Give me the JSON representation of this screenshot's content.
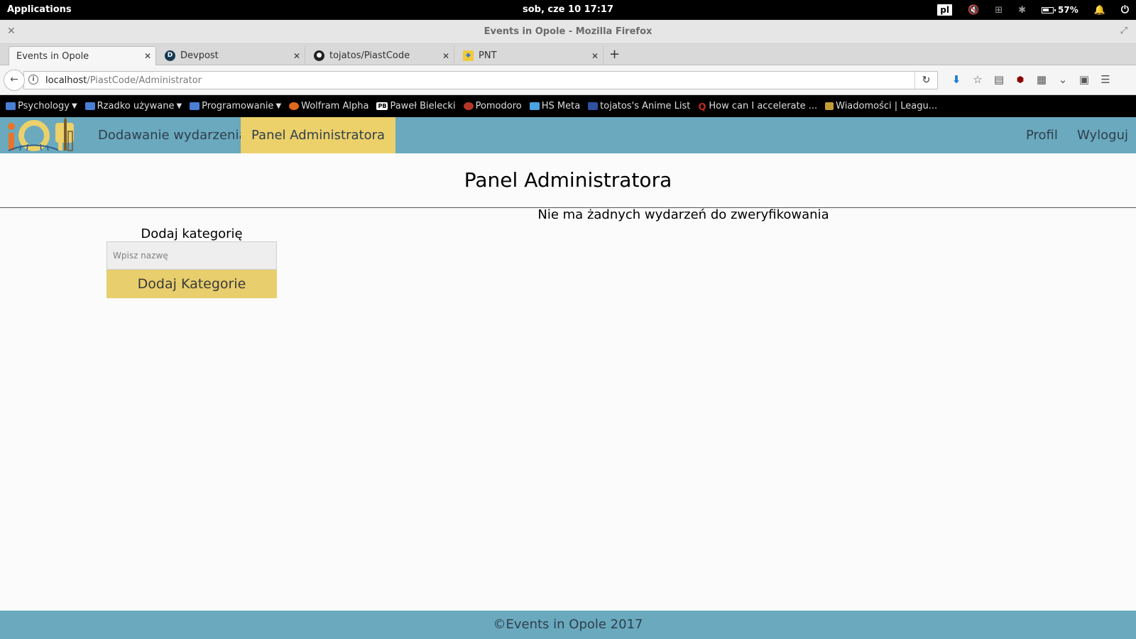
{
  "os": {
    "applications": "Applications",
    "clock": "sob, cze 10    17:17",
    "keyboard_layout": "pl",
    "battery": "57%"
  },
  "window": {
    "title": "Events in Opole - Mozilla Firefox"
  },
  "tabs": [
    {
      "label": "Events in Opole",
      "favicon": "none"
    },
    {
      "label": "Devpost",
      "favicon": "D"
    },
    {
      "label": "tojatos/PiastCode",
      "favicon": "github-icon"
    },
    {
      "label": "PNT",
      "favicon": "pnt-icon"
    }
  ],
  "urlbar": {
    "host": "localhost",
    "path": "/PiastCode/Administrator"
  },
  "bookmarks": [
    {
      "label": "Psychology",
      "icon": "folder-icon"
    },
    {
      "label": "Rzadko używane",
      "icon": "folder-icon"
    },
    {
      "label": "Programowanie",
      "icon": "folder-icon"
    },
    {
      "label": "Wolfram Alpha",
      "icon": "wolfram-icon"
    },
    {
      "label": "Paweł Bielecki",
      "icon": "pb-icon",
      "badge": "PB"
    },
    {
      "label": "Pomodoro",
      "icon": "tomato-icon"
    },
    {
      "label": "HS Meta",
      "icon": "hs-icon"
    },
    {
      "label": "tojatos's Anime List",
      "icon": "mal-icon"
    },
    {
      "label": "How can I accelerate ...",
      "icon": "quora-icon",
      "badge": "Q"
    },
    {
      "label": "Wiadomości | Leagu...",
      "icon": "league-icon"
    }
  ],
  "site": {
    "nav": {
      "add_event": "Dodawanie wydarzenia",
      "admin_panel": "Panel Administratora",
      "profile": "Profil",
      "logout": "Wyloguj"
    },
    "page_title": "Panel Administratora",
    "category": {
      "title": "Dodaj kategorię",
      "placeholder": "Wpisz nazwę",
      "button": "Dodaj Kategorie"
    },
    "empty_message": "Nie ma żadnych wydarzeń do zweryfikowania",
    "footer": "©Events in Opole 2017"
  },
  "colors": {
    "nav_bg": "#6aa9be",
    "accent_yellow": "#ecd06a",
    "logo_orange": "#e8742a"
  }
}
